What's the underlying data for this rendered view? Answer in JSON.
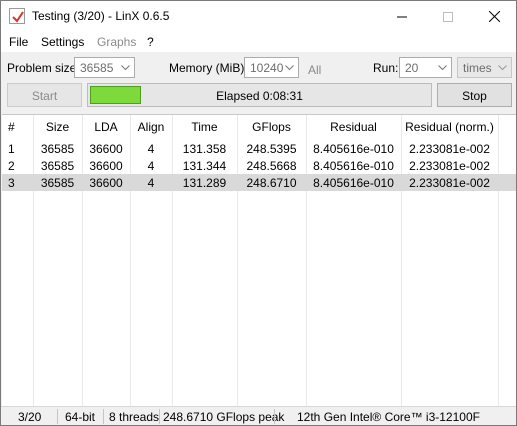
{
  "window": {
    "title": "Testing (3/20) - LinX 0.6.5"
  },
  "menu": [
    "File",
    "Settings",
    "Graphs",
    "?"
  ],
  "controls": {
    "problem_size_label": "Problem size:",
    "problem_size_value": "36585",
    "memory_label": "Memory (MiB):",
    "memory_value": "10240",
    "all_label": "All",
    "run_label": "Run:",
    "run_value": "20",
    "run_unit": "times",
    "start_label": "Start",
    "stop_label": "Stop",
    "elapsed": "Elapsed 0:08:31",
    "progress_fraction": 0.15
  },
  "table": {
    "columns": [
      "#",
      "Size",
      "LDA",
      "Align",
      "Time",
      "GFlops",
      "Residual",
      "Residual (norm.)"
    ],
    "rows": [
      [
        "1",
        "36585",
        "36600",
        "4",
        "131.358",
        "248.5395",
        "8.405616e-010",
        "2.233081e-002"
      ],
      [
        "2",
        "36585",
        "36600",
        "4",
        "131.344",
        "248.5668",
        "8.405616e-010",
        "2.233081e-002"
      ],
      [
        "3",
        "36585",
        "36600",
        "4",
        "131.289",
        "248.6710",
        "8.405616e-010",
        "2.233081e-002"
      ]
    ],
    "selected_row": 2
  },
  "status": {
    "progress": "3/20",
    "bits": "64-bit",
    "threads": "8 threads",
    "peak": "248.6710 GFlops peak",
    "cpu": "12th Gen Intel® Core™ i3-12100F"
  },
  "colors": {
    "progress_fill": "#7ed93a",
    "selected_row": "#d9d9d9"
  }
}
